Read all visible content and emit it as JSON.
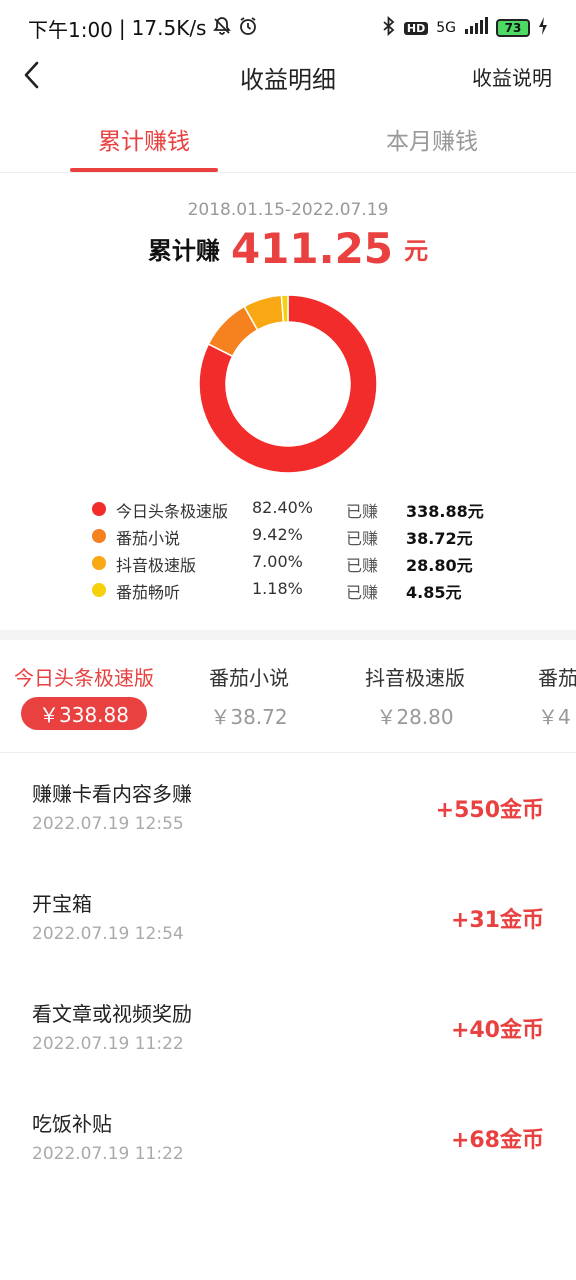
{
  "status_bar": {
    "time": "下午1:00",
    "speed": "17.5K/s",
    "hd": "HD",
    "network": "5G",
    "battery": "73"
  },
  "nav": {
    "title": "收益明细",
    "right_action": "收益说明"
  },
  "tabs": [
    {
      "label": "累计赚钱",
      "active": true
    },
    {
      "label": "本月赚钱",
      "active": false
    }
  ],
  "summary": {
    "date_range": "2018.01.15-2022.07.19",
    "label": "累计赚",
    "total": "411.25",
    "unit": "元"
  },
  "chart_data": {
    "type": "pie",
    "categories": [
      "今日头条极速版",
      "番茄小说",
      "抖音极速版",
      "番茄畅听"
    ],
    "values": [
      82.4,
      9.42,
      7.0,
      1.18
    ],
    "colors": [
      "#f22b2b",
      "#f5811f",
      "#f7a813",
      "#f5d10d"
    ]
  },
  "legend": [
    {
      "name": "今日头条极速版",
      "pct": "82.40%",
      "earned_label": "已赚",
      "amount": "338.88元",
      "color": "#f22b2b"
    },
    {
      "name": "番茄小说",
      "pct": "9.42%",
      "earned_label": "已赚",
      "amount": "38.72元",
      "color": "#f5811f"
    },
    {
      "name": "抖音极速版",
      "pct": "7.00%",
      "earned_label": "已赚",
      "amount": "28.80元",
      "color": "#f7a813"
    },
    {
      "name": "番茄畅听",
      "pct": "1.18%",
      "earned_label": "已赚",
      "amount": "4.85元",
      "color": "#f5d10d"
    }
  ],
  "platform_tabs": [
    {
      "name": "今日头条极速版",
      "amount": "￥338.88",
      "active": true
    },
    {
      "name": "番茄小说",
      "amount": "￥38.72",
      "active": false
    },
    {
      "name": "抖音极速版",
      "amount": "￥28.80",
      "active": false
    },
    {
      "name": "番茄",
      "amount": "￥4",
      "active": false
    }
  ],
  "records": [
    {
      "title": "赚赚卡看内容多赚",
      "time": "2022.07.19 12:55",
      "coins": "+550金币"
    },
    {
      "title": "开宝箱",
      "time": "2022.07.19 12:54",
      "coins": "+31金币"
    },
    {
      "title": "看文章或视频奖励",
      "time": "2022.07.19 11:22",
      "coins": "+40金币"
    },
    {
      "title": "吃饭补贴",
      "time": "2022.07.19 11:22",
      "coins": "+68金币"
    }
  ]
}
